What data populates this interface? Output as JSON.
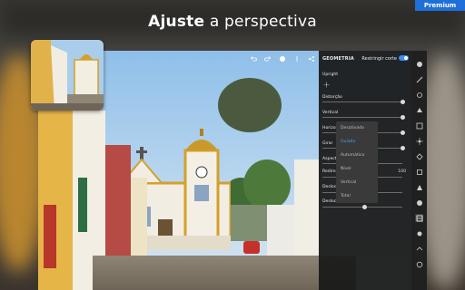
{
  "headline": {
    "bold": "Ajuste",
    "rest": " a perspectiva"
  },
  "badge": {
    "premium": "Premium"
  },
  "panel": {
    "title": "GEOMETRIA",
    "crop_label": "Restringir corte",
    "crop_enabled": true,
    "rows": [
      {
        "label": "Upright",
        "value": ""
      },
      {
        "label": "Distorção",
        "value": ""
      },
      {
        "label": "Vertical",
        "value": ""
      },
      {
        "label": "Horizontal",
        "value": ""
      },
      {
        "label": "Girar",
        "value": ""
      },
      {
        "label": "Aspecto",
        "value": ""
      },
      {
        "label": "Redimensionar",
        "value": "100"
      },
      {
        "label": "Deslocamento X",
        "value": ""
      },
      {
        "label": "Deslocamento Y",
        "value": ""
      }
    ],
    "upright_options": [
      "Desativado",
      "Guiado",
      "Automático",
      "Nível",
      "Vertical",
      "Total"
    ],
    "upright_selected": "Guiado"
  },
  "toolbar_icons": [
    "undo-icon",
    "redo-icon",
    "info-icon",
    "more-icon",
    "share-icon",
    "settings-icon"
  ],
  "rail_icons": [
    "profile-icon",
    "auto-icon",
    "light-icon",
    "color-icon",
    "effects-icon",
    "detail-icon",
    "optics-icon",
    "geometry-icon",
    "crop-icon",
    "heal-icon",
    "brush-icon",
    "radial-icon",
    "versions-icon",
    "help-icon"
  ],
  "colors": {
    "accent": "#3a8ef6",
    "premium": "#1e6fd9",
    "panel": "#1a1a1a"
  }
}
